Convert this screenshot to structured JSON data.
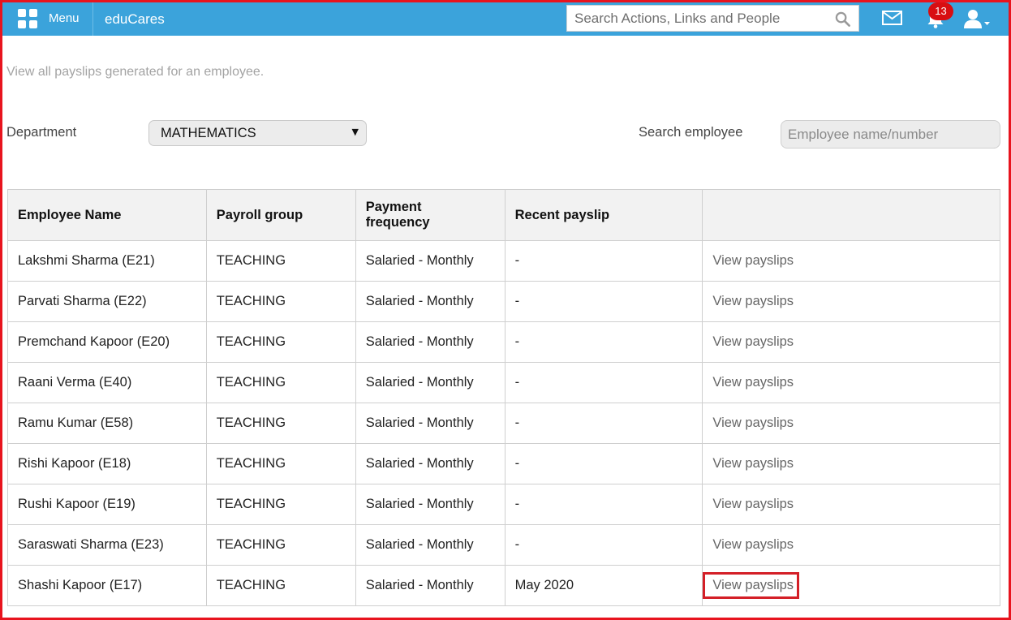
{
  "header": {
    "menu_label": "Menu",
    "brand": "eduCares",
    "search_placeholder": "Search Actions, Links and People",
    "notification_count": "13",
    "icons": [
      "grid-icon",
      "search-icon",
      "mail-icon",
      "bell-icon",
      "user-icon"
    ],
    "bar_color": "#3ba3db"
  },
  "page": {
    "subtitle": "View all payslips generated for an employee.",
    "department_label": "Department",
    "department_value": "MATHEMATICS",
    "search_label": "Search employee",
    "search_placeholder": "Employee name/number"
  },
  "table": {
    "headers": [
      "Employee Name",
      "Payroll group",
      "Payment frequency",
      "Recent payslip",
      ""
    ],
    "rows": [
      {
        "name": "Lakshmi Sharma (E21)",
        "group": "TEACHING",
        "frequency": "Salaried - Monthly",
        "recent": "-",
        "action": "View payslips"
      },
      {
        "name": "Parvati Sharma (E22)",
        "group": "TEACHING",
        "frequency": "Salaried - Monthly",
        "recent": "-",
        "action": "View payslips"
      },
      {
        "name": "Premchand Kapoor (E20)",
        "group": "TEACHING",
        "frequency": "Salaried - Monthly",
        "recent": "-",
        "action": "View payslips"
      },
      {
        "name": "Raani Verma (E40)",
        "group": "TEACHING",
        "frequency": "Salaried - Monthly",
        "recent": "-",
        "action": "View payslips"
      },
      {
        "name": "Ramu Kumar (E58)",
        "group": "TEACHING",
        "frequency": "Salaried - Monthly",
        "recent": "-",
        "action": "View payslips"
      },
      {
        "name": "Rishi Kapoor (E18)",
        "group": "TEACHING",
        "frequency": "Salaried - Monthly",
        "recent": "-",
        "action": "View payslips"
      },
      {
        "name": "Rushi Kapoor (E19)",
        "group": "TEACHING",
        "frequency": "Salaried - Monthly",
        "recent": "-",
        "action": "View payslips"
      },
      {
        "name": "Saraswati Sharma (E23)",
        "group": "TEACHING",
        "frequency": "Salaried - Monthly",
        "recent": "-",
        "action": "View payslips"
      },
      {
        "name": "Shashi Kapoor (E17)",
        "group": "TEACHING",
        "frequency": "Salaried - Monthly",
        "recent": "May 2020",
        "action": "View payslips",
        "highlighted": true
      }
    ]
  },
  "colors": {
    "highlight_border": "#d41f27",
    "badge": "#d80e12",
    "frame_border": "#e8141e"
  }
}
